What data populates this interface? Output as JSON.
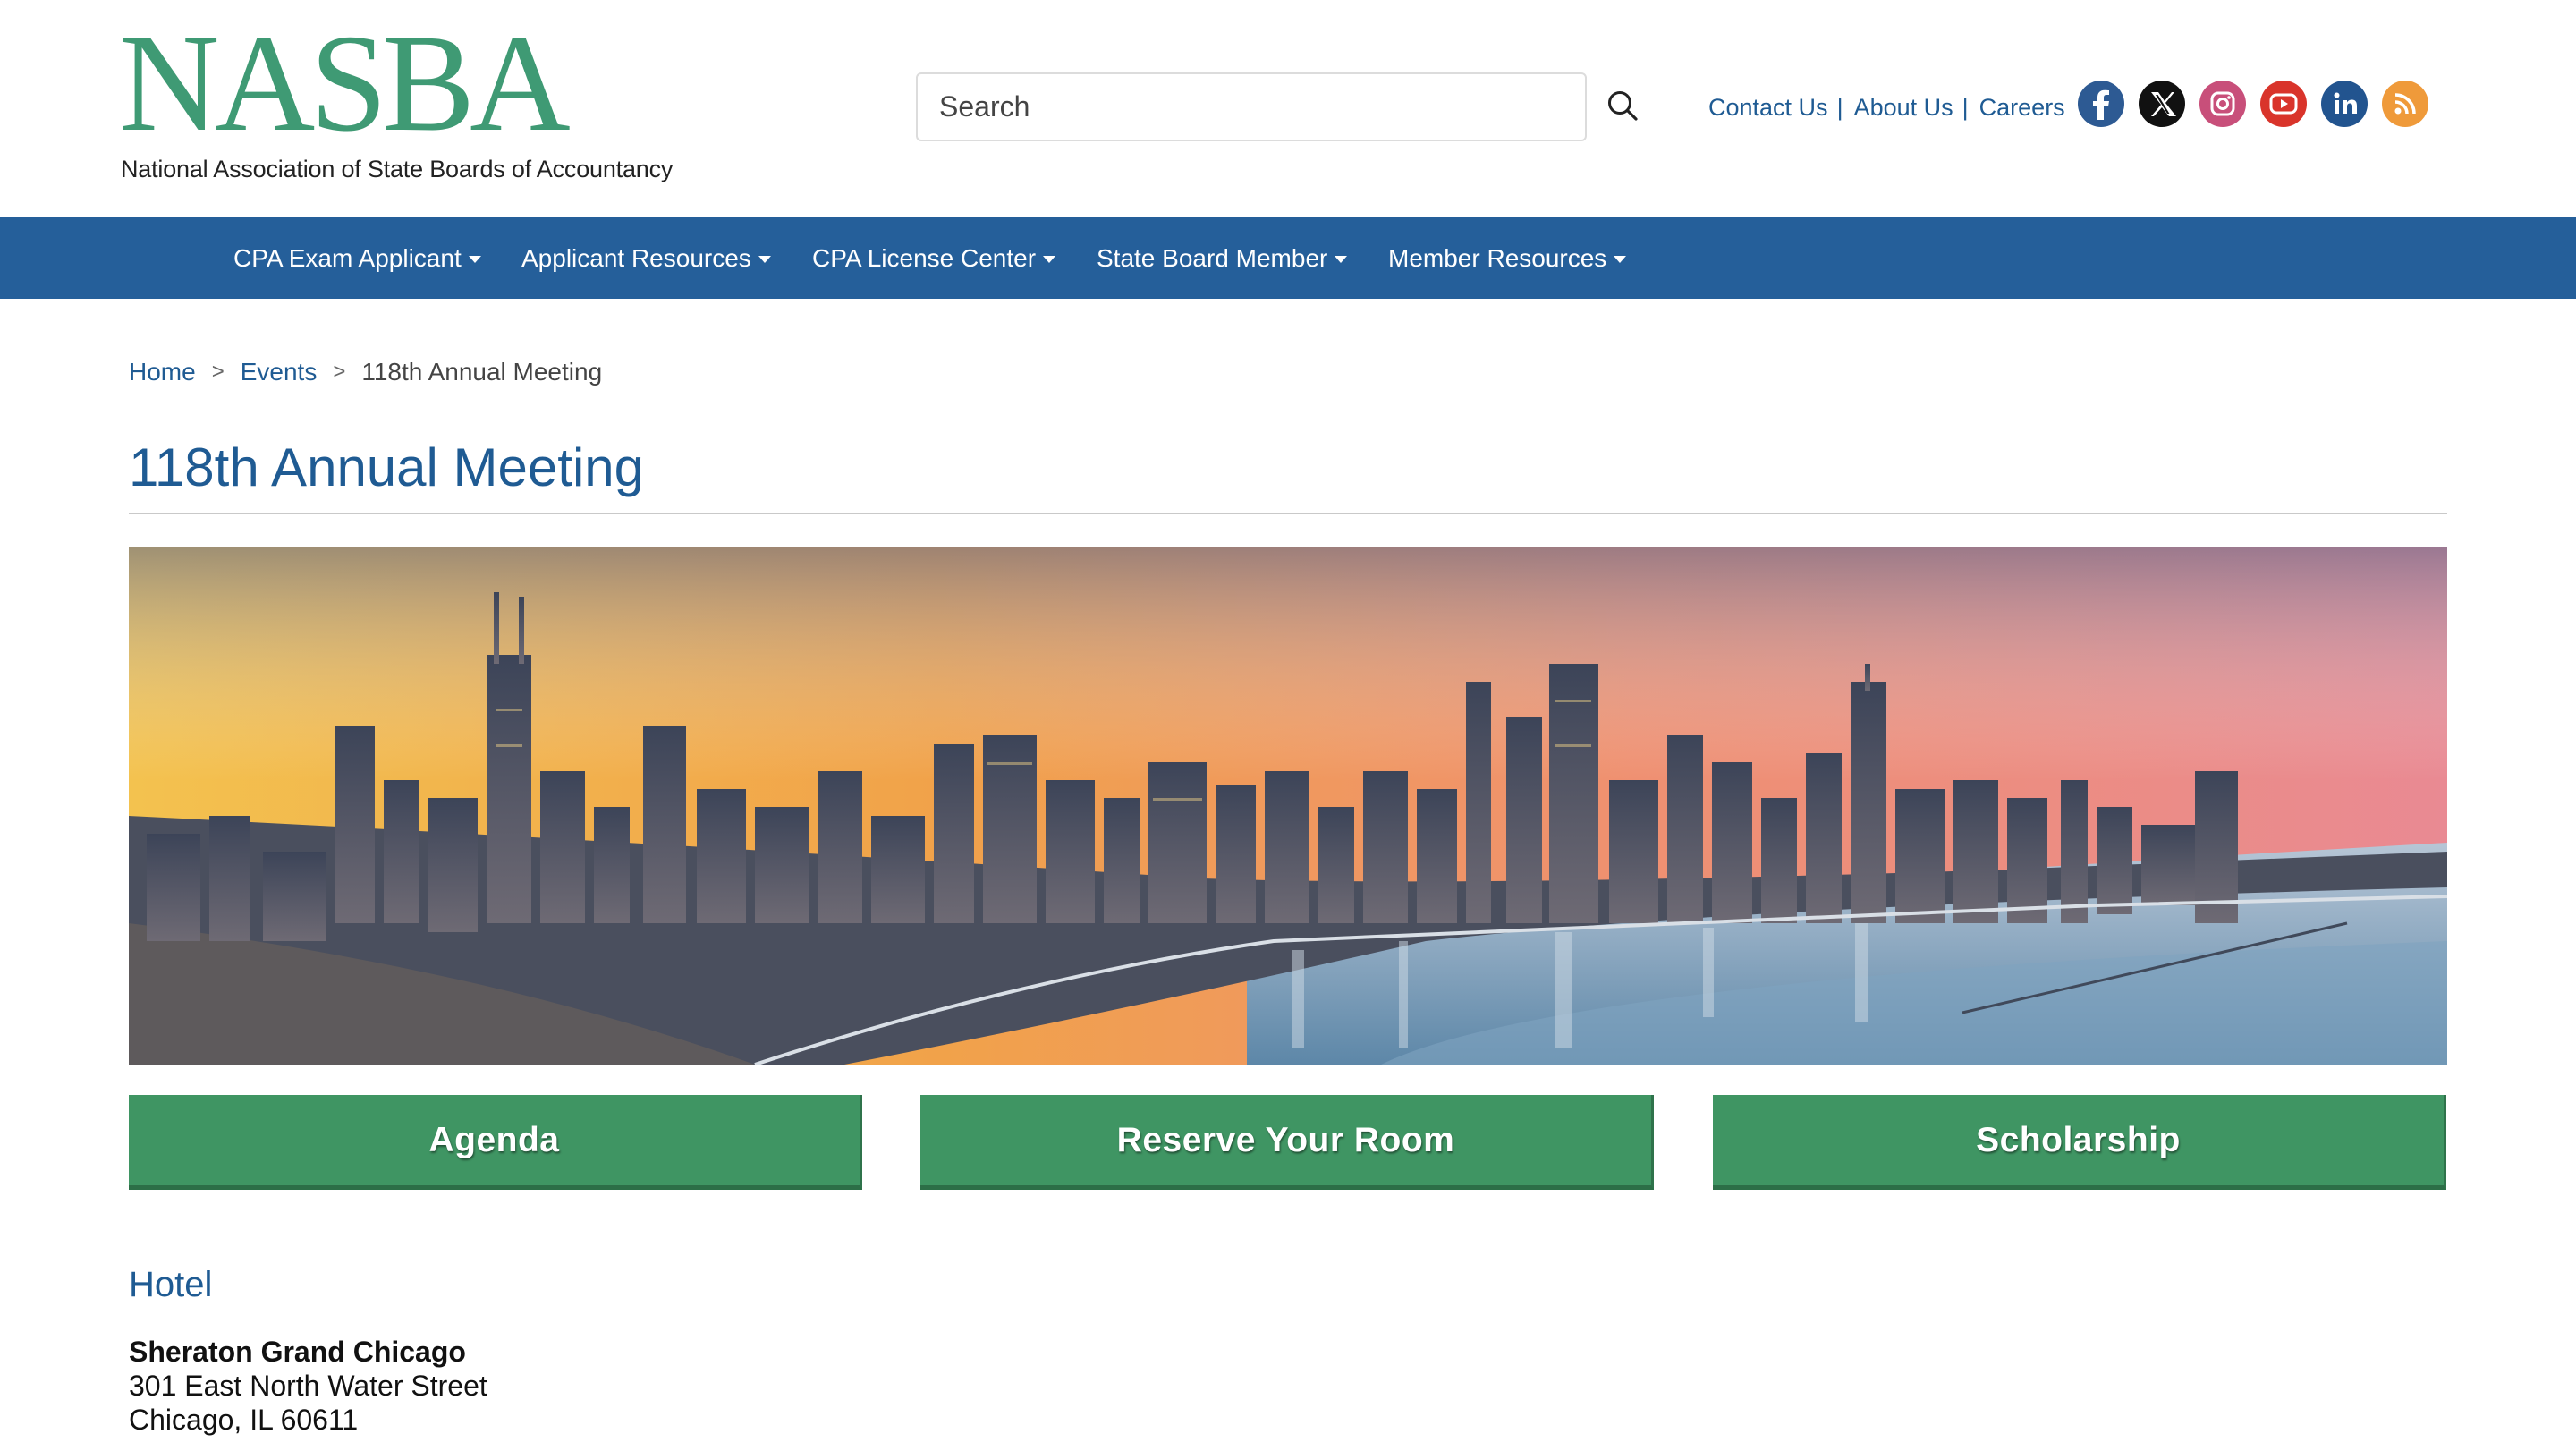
{
  "header": {
    "logo": {
      "wordmark": "NASBA",
      "subtitle": "National Association of State Boards of Accountancy"
    },
    "search": {
      "placeholder": "Search",
      "value": ""
    },
    "top_links": [
      "Contact Us",
      "About Us",
      "Careers"
    ],
    "socials": [
      {
        "name": "facebook-icon",
        "color": "#2d5a93"
      },
      {
        "name": "x-twitter-icon",
        "color": "#111111"
      },
      {
        "name": "instagram-icon",
        "color": "#c84f7a"
      },
      {
        "name": "youtube-icon",
        "color": "#d9342b"
      },
      {
        "name": "linkedin-icon",
        "color": "#22548f"
      },
      {
        "name": "rss-icon",
        "color": "#ef9a3a"
      }
    ]
  },
  "nav": {
    "items": [
      {
        "label": "CPA Exam Applicant"
      },
      {
        "label": "Applicant Resources"
      },
      {
        "label": "CPA License Center"
      },
      {
        "label": "State Board Member"
      },
      {
        "label": "Member Resources"
      }
    ]
  },
  "breadcrumb": {
    "home": "Home",
    "events": "Events",
    "current": "118th Annual Meeting",
    "separator": ">"
  },
  "page": {
    "title": "118th Annual Meeting"
  },
  "actions": {
    "agenda": "Agenda",
    "reserve": "Reserve Your Room",
    "scholarship": "Scholarship"
  },
  "hotel": {
    "heading": "Hotel",
    "name": "Sheraton Grand Chicago",
    "street": "301 East North Water Street",
    "city": "Chicago, IL 60611"
  },
  "colors": {
    "brand_green": "#3f9a74",
    "nav_blue": "#255f9a",
    "link_blue": "#1f5b93",
    "button_green": "#3f9563"
  }
}
